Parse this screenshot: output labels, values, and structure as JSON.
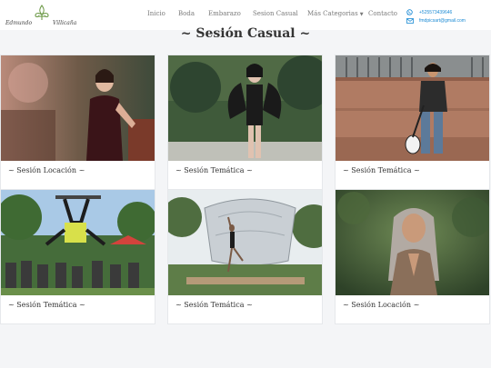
{
  "logo": {
    "first": "Edmundo",
    "last": "Villicaña"
  },
  "nav": {
    "items": [
      "Inicio",
      "Boda",
      "Embarazo",
      "Sesion Casual",
      "Más Categorias",
      "Contacto"
    ]
  },
  "contact": {
    "phone": "+525573439646",
    "email": "fmdpicsart@gmail.com"
  },
  "page_title": "~ Sesión Casual ~",
  "gallery": [
    {
      "caption": "~ Sesión Locación ~"
    },
    {
      "caption": "~ Sesión Temática ~"
    },
    {
      "caption": "~ Sesión Temática ~"
    },
    {
      "caption": "~ Sesión Temática ~"
    },
    {
      "caption": "~ Sesión Temática ~"
    },
    {
      "caption": "~ Sesión Locación ~"
    }
  ],
  "colors": {
    "link": "#1a8ad4",
    "nav_text": "#7a7a7a",
    "background": "#f4f5f7"
  }
}
